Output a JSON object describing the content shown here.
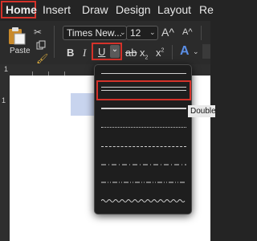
{
  "tabs": [
    "Home",
    "Insert",
    "Draw",
    "Design",
    "Layout",
    "Re"
  ],
  "paste_label": "Paste",
  "font": {
    "name": "Times New...",
    "size": "12",
    "grow": "A^",
    "shrink": "A^"
  },
  "format_buttons": {
    "bold": "B",
    "italic": "I",
    "underline": "U",
    "subscript": "x",
    "superscript": "x"
  },
  "tooltip": "Double underline",
  "ruler_marks": [
    "1",
    "1"
  ]
}
